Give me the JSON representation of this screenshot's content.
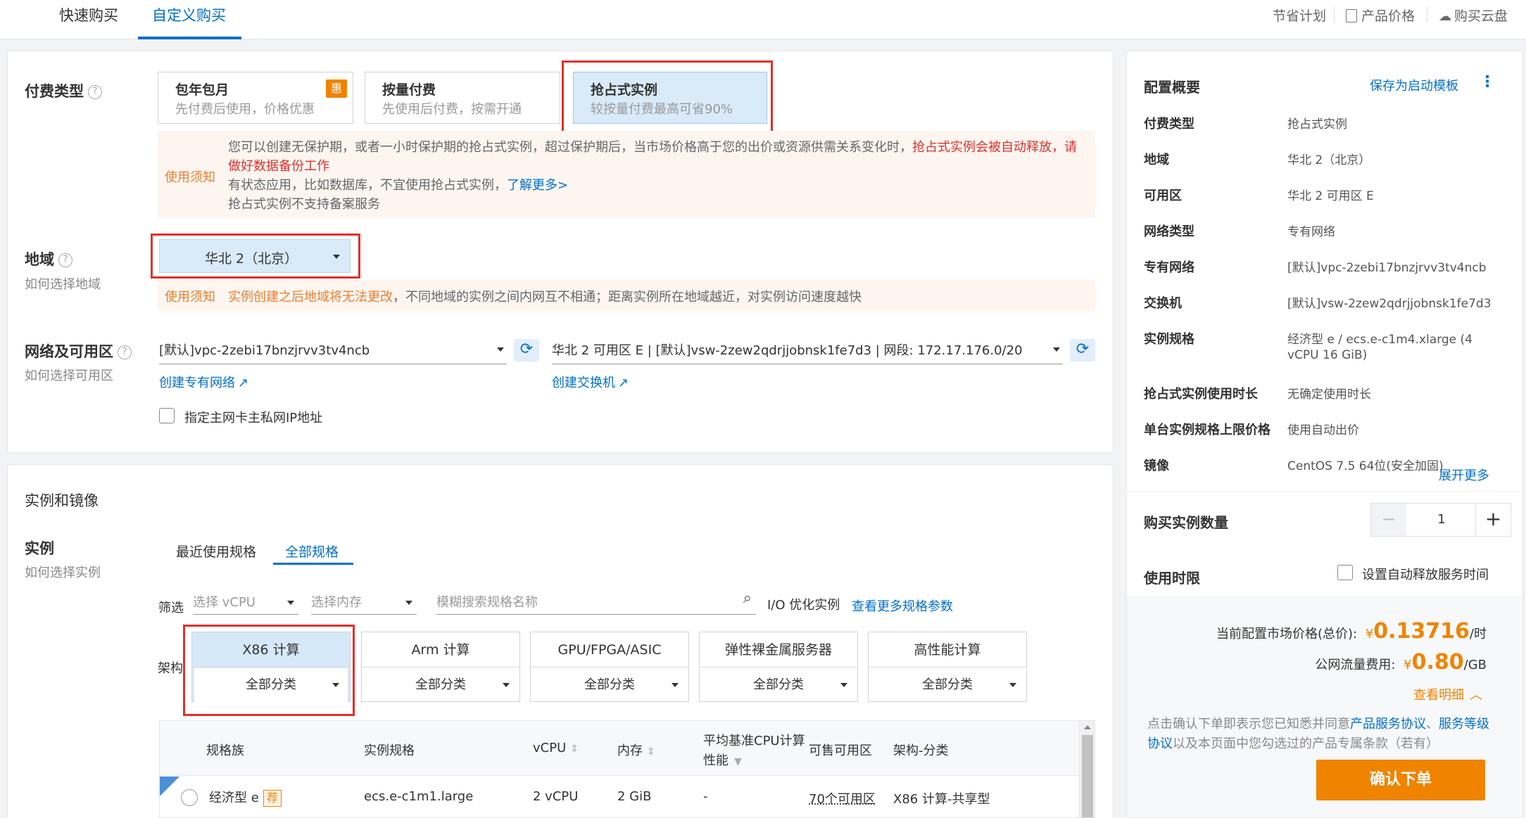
{
  "nav": {
    "tabs": [
      "快速购买",
      "自定义购买"
    ],
    "right": [
      "节省计划",
      "产品价格",
      "购买云盘"
    ]
  },
  "pay_type": {
    "label": "付费类型",
    "options": [
      {
        "title": "包年包月",
        "sub": "先付费后使用，价格优惠",
        "badge": "惠"
      },
      {
        "title": "按量付费",
        "sub": "先使用后付费，按需开通"
      },
      {
        "title": "抢占式实例",
        "sub": "较按量付费最高可省90%"
      }
    ],
    "notice_tag": "使用须知",
    "notice_line1": "您可以创建无保护期，或者一小时保护期的抢占式实例，超过保护期后，当市场价格高于您的出价或资源供需关系变化时，",
    "notice_line1_red": "抢占式实例会被自动释放，请",
    "notice_line2_red": "做好数据备份工作",
    "notice_line3": "有状态应用，比如数据库，不宜使用抢占式实例，",
    "notice_line3_link": "了解更多>",
    "notice_line4": "抢占式实例不支持备案服务"
  },
  "region": {
    "label": "地域",
    "sub": "如何选择地域",
    "selected": "华北 2（北京）",
    "notice_tag": "使用须知",
    "notice_orange": "实例创建之后地域将无法更改",
    "notice_rest": "，不同地域的实例之间内网互不相通；距离实例所在地域越近，对实例访问速度越快"
  },
  "network": {
    "label": "网络及可用区",
    "sub": "如何选择可用区",
    "vpc": "[默认]vpc-2zebi17bnzjrvv3tv4ncb",
    "vswitch": "华北 2 可用区 E | [默认]vsw-2zew2qdrjjobnsk1fe7d3 | 网段: 172.17.176.0/20",
    "create_vpc": "创建专有网络",
    "create_vsw": "创建交换机",
    "checkbox_label": "指定主网卡主私网IP地址"
  },
  "instance_section": {
    "title": "实例和镜像",
    "label": "实例",
    "sub": "如何选择实例",
    "tabs": [
      "最近使用规格",
      "全部规格"
    ],
    "filter_label": "筛选",
    "vcpu_placeholder": "选择 vCPU",
    "mem_placeholder": "选择内存",
    "search_placeholder": "模糊搜索规格名称",
    "io_label": "I/O 优化实例",
    "more_link": "查看更多规格参数",
    "arch_label": "架构",
    "arch": [
      {
        "top": "X86 计算",
        "bottom": "全部分类"
      },
      {
        "top": "Arm 计算",
        "bottom": "全部分类"
      },
      {
        "top": "GPU/FPGA/ASIC",
        "bottom": "全部分类"
      },
      {
        "top": "弹性裸金属服务器",
        "bottom": "全部分类"
      },
      {
        "top": "高性能计算",
        "bottom": "全部分类"
      }
    ],
    "table_headers": [
      "规格族",
      "实例规格",
      "vCPU",
      "内存",
      "平均基准CPU计算",
      "性能",
      "可售可用区",
      "架构-分类"
    ],
    "row": {
      "family": "经济型 e",
      "badge": "荐",
      "spec": "ecs.e-c1m1.large",
      "vcpu": "2 vCPU",
      "mem": "2 GiB",
      "perf": "-",
      "zones": "70个可用区",
      "arch": "X86 计算-共享型"
    }
  },
  "summary": {
    "title": "配置概要",
    "save_link": "保存为启动模板",
    "rows": [
      {
        "k": "付费类型",
        "v": "抢占式实例"
      },
      {
        "k": "地域",
        "v": "华北 2（北京）"
      },
      {
        "k": "可用区",
        "v": "华北 2 可用区 E"
      },
      {
        "k": "网络类型",
        "v": "专有网络"
      },
      {
        "k": "专有网络",
        "v": "[默认]vpc-2zebi17bnzjrvv3tv4ncb"
      },
      {
        "k": "交换机",
        "v": "[默认]vsw-2zew2qdrjjobnsk1fe7d3"
      },
      {
        "k": "实例规格",
        "v": "经济型 e / ecs.e-c1m4.xlarge (4",
        "v2": "vCPU 16 GiB)"
      },
      {
        "k": "抢占式实例使用时长",
        "v": "无确定使用时长"
      },
      {
        "k": "单台实例规格上限价格",
        "v": "使用自动出价"
      },
      {
        "k": "镜像",
        "v": "CentOS 7.5 64位(安全加固)"
      }
    ],
    "expand_link": "展开更多",
    "qty_label": "购买实例数量",
    "qty_value": "1",
    "duration_label": "使用时限",
    "auto_release_label": "设置自动释放服务时间",
    "price_label": "当前配置市场价格(总价):",
    "price_currency": "¥",
    "price_value": "0.13716",
    "price_unit": "/时",
    "traffic_label": "公网流量费用:",
    "traffic_currency": "¥",
    "traffic_value": "0.80",
    "traffic_unit": "/GB",
    "detail_link": "查看明细",
    "agree_prefix": "点击确认下单即表示您已知悉并同意",
    "agree_link1": "产品服务协议",
    "agree_sep": "、",
    "agree_link2": "服务等",
    "agree_link2b": "级协议",
    "agree_suffix": "以及本页面中您勾选过的产品专属条款（若有）",
    "confirm_button": "确认下单"
  }
}
